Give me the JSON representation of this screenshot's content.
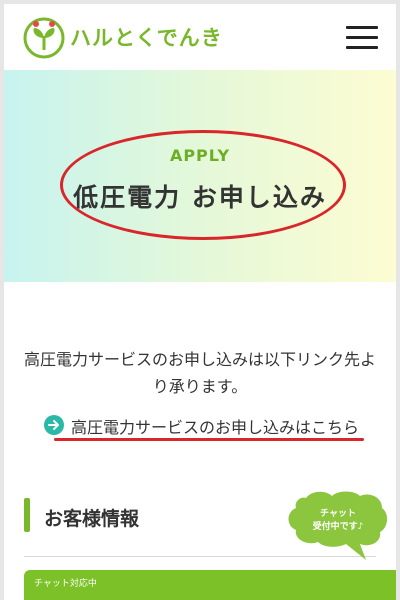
{
  "header": {
    "brand": "ハルとくでんき",
    "logo_icon": "sprout-logo-icon",
    "menu_icon": "hamburger-menu-icon"
  },
  "hero": {
    "subtitle": "APPLY",
    "title": "低圧電力 お申し込み"
  },
  "main": {
    "description": "高圧電力サービスのお申し込みは以下リンク先より承ります。",
    "link_text": "高圧電力サービスのお申し込みはこちら",
    "link_icon": "arrow-right-icon",
    "section_title": "お客様情報"
  },
  "chat": {
    "bubble_line1": "チャット",
    "bubble_line2": "受付中です♪",
    "bar_text": "チャット対応中"
  },
  "colors": {
    "brand_green": "#78b82a",
    "accent_teal": "#2ab9a6",
    "annotation_red": "#d9262a"
  }
}
